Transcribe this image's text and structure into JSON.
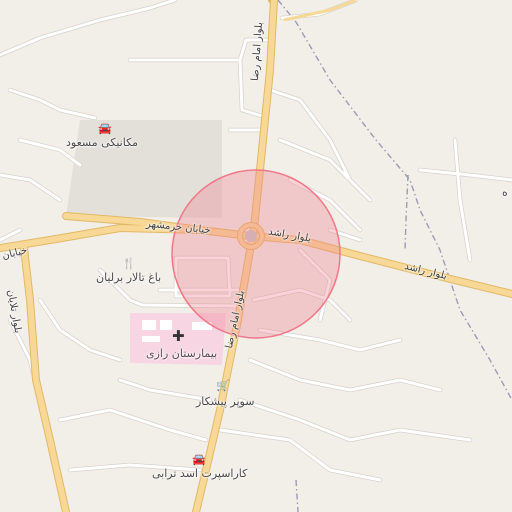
{
  "map": {
    "road_labels": {
      "imam_reza_north": "بلوار امام رضا",
      "imam_reza_south": "بلوار امام رضا",
      "rashed_near": "بلوار راشد",
      "rashed_far": "بلوار راشد",
      "khorramshahr": "خیابان خرمشهر",
      "khayaban_west": "خیابان",
      "vertical_west": "بلوار تلایان"
    },
    "poi_labels": {
      "mechanic": "مکانیکی مسعود",
      "garden": "باغ تالار برلیان",
      "hospital": "بیمارستان رازی",
      "supermarket": "سوپر پیشکار",
      "carwash": "کاراسپرت اسد ترابی",
      "edge_label": "ه"
    },
    "icons": {
      "mechanic": "car-icon",
      "garden": "restaurant-icon",
      "hospital": "hospital-cross-icon",
      "supermarket": "shopping-basket-icon",
      "carwash": "car-icon"
    },
    "colors": {
      "background": "#f2efe9",
      "major_road": "#f7d896",
      "major_road_casing": "#e2b866",
      "minor_road": "#ffffff",
      "minor_road_casing": "#d6d2cb",
      "hospital_area": "#f7d5e3",
      "lot_area": "#e3e0da",
      "admin_boundary": "#9b9bb5",
      "highlight_circle": "#f08090"
    }
  }
}
